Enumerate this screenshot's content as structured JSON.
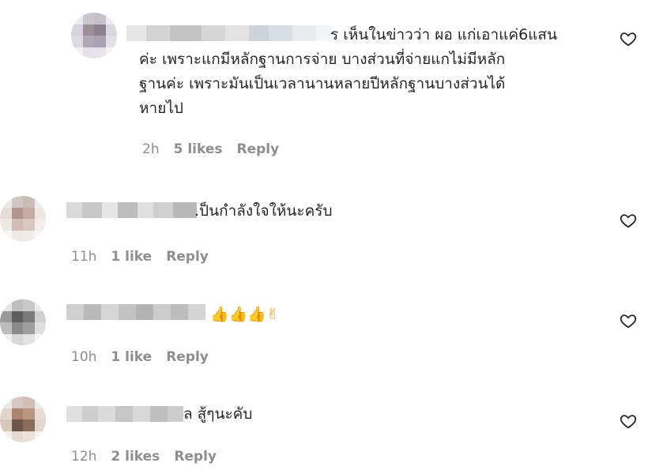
{
  "comments": [
    {
      "text": "ร เห็นในข่าวว่า ผอ แก่เอาแค่6แสน\nค่ะ เพราะแกมีหลักฐานการจ่าย บางส่วนที่จ่ายแกไม่มีหลัก\nฐานค่ะ เพราะมันเป็นเวลานานหลายปีหลักฐานบางส่วนได้\nหายไป",
      "time": "2h",
      "likes": "5 likes",
      "reply": "Reply"
    },
    {
      "text": ".ป็นกำลังใจให้นะครับ",
      "time": "11h",
      "likes": "1 like",
      "reply": "Reply"
    },
    {
      "text": "",
      "emoji": "👍👍👍✌",
      "time": "10h",
      "likes": "1 like",
      "reply": "Reply"
    },
    {
      "text": "ล สู้ๆนะคับ",
      "time": "12h",
      "likes": "2 likes",
      "reply": "Reply"
    }
  ],
  "icons": {
    "like": "heart-outline-icon"
  },
  "colors": {
    "text": "#262626",
    "meta": "#8e8e8e"
  }
}
